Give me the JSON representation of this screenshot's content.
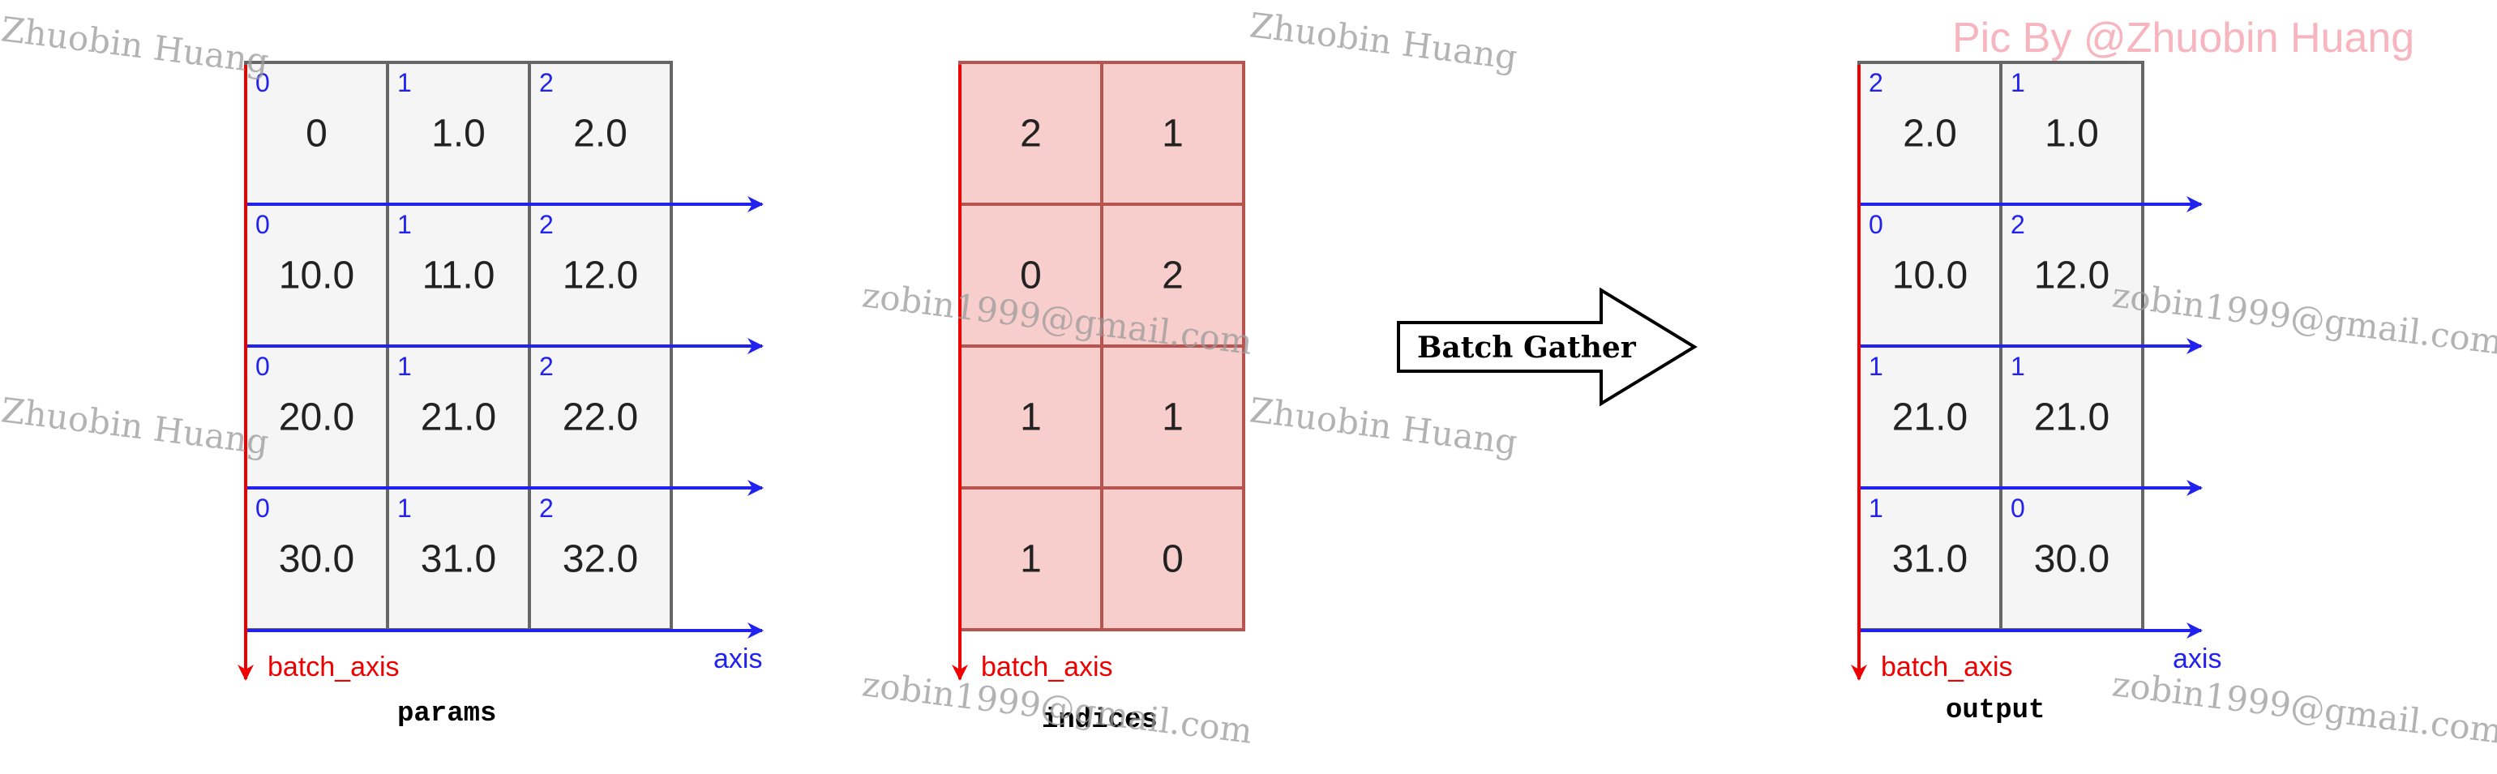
{
  "params": {
    "values": [
      [
        "0",
        "1.0",
        "2.0"
      ],
      [
        "10.0",
        "11.0",
        "12.0"
      ],
      [
        "20.0",
        "21.0",
        "22.0"
      ],
      [
        "30.0",
        "31.0",
        "32.0"
      ]
    ],
    "indices": [
      [
        "0",
        "1",
        "2"
      ],
      [
        "0",
        "1",
        "2"
      ],
      [
        "0",
        "1",
        "2"
      ],
      [
        "0",
        "1",
        "2"
      ]
    ],
    "caption": "params",
    "batch_axis_label": "batch_axis",
    "axis_label": "axis"
  },
  "indices": {
    "values": [
      [
        "2",
        "1"
      ],
      [
        "0",
        "2"
      ],
      [
        "1",
        "1"
      ],
      [
        "1",
        "0"
      ]
    ],
    "caption": "indices",
    "batch_axis_label": "batch_axis"
  },
  "output": {
    "values": [
      [
        "2.0",
        "1.0"
      ],
      [
        "10.0",
        "12.0"
      ],
      [
        "21.0",
        "21.0"
      ],
      [
        "31.0",
        "30.0"
      ]
    ],
    "indices": [
      [
        "2",
        "1"
      ],
      [
        "0",
        "2"
      ],
      [
        "1",
        "1"
      ],
      [
        "1",
        "0"
      ]
    ],
    "caption": "output",
    "batch_axis_label": "batch_axis",
    "axis_label": "axis"
  },
  "operation": {
    "label": "Batch Gather"
  },
  "watermarks": {
    "name_1": "Zhuobin Huang",
    "name_2": "Zhuobin Huang",
    "name_3": "Zhuobin Huang",
    "name_4": "Zhuobin Huang",
    "email_1": "zobin1999@gmail.com",
    "email_2": "zobin1999@gmail.com",
    "email_3": "zobin1999@gmail.com",
    "email_4": "zobin1999@gmail.com",
    "pic_by": "Pic By @Zhuobin Huang"
  },
  "colors": {
    "cell_fill": "#f5f5f5",
    "cell_stroke": "#666666",
    "index_fill": "#f8cecc",
    "index_stroke": "#b85450",
    "batch_axis": "#ee0000",
    "axis": "#2222ee"
  }
}
